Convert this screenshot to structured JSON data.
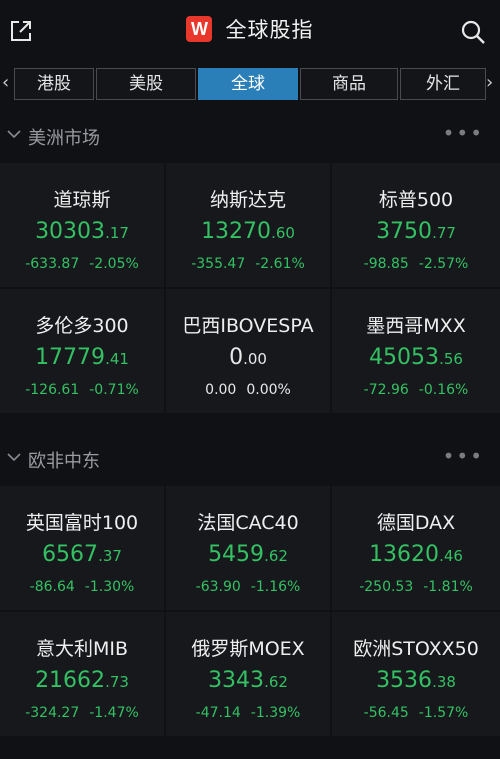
{
  "header": {
    "title": "全球股指",
    "logo_letter": "W",
    "icons": {
      "left": "share-external-icon",
      "right": "search-icon"
    }
  },
  "tabs": {
    "items": [
      {
        "label": "港股"
      },
      {
        "label": "美股"
      },
      {
        "label": "全球",
        "active": true
      },
      {
        "label": "商品"
      },
      {
        "label": "外汇"
      }
    ],
    "left_arrow": "‹",
    "right_arrow": "›"
  },
  "sections": [
    {
      "title": "美洲市场",
      "more": "•••",
      "items": [
        {
          "name": "道琼斯",
          "price_int": "30303",
          "price_dec": ".17",
          "change": "-633.87",
          "pct": "-2.05%"
        },
        {
          "name": "纳斯达克",
          "price_int": "13270",
          "price_dec": ".60",
          "change": "-355.47",
          "pct": "-2.61%"
        },
        {
          "name": "标普500",
          "price_int": "3750",
          "price_dec": ".77",
          "change": "-98.85",
          "pct": "-2.57%"
        },
        {
          "name": "多伦多300",
          "price_int": "17779",
          "price_dec": ".41",
          "change": "-126.61",
          "pct": "-0.71%"
        },
        {
          "name": "巴西IBOVESPA",
          "price_int": "0",
          "price_dec": ".00",
          "change": "0.00",
          "pct": "0.00%"
        },
        {
          "name": "墨西哥MXX",
          "price_int": "45053",
          "price_dec": ".56",
          "change": "-72.96",
          "pct": "-0.16%"
        }
      ]
    },
    {
      "title": "欧非中东",
      "more": "•••",
      "items": [
        {
          "name": "英国富时100",
          "price_int": "6567",
          "price_dec": ".37",
          "change": "-86.64",
          "pct": "-1.30%"
        },
        {
          "name": "法国CAC40",
          "price_int": "5459",
          "price_dec": ".62",
          "change": "-63.90",
          "pct": "-1.16%"
        },
        {
          "name": "德国DAX",
          "price_int": "13620",
          "price_dec": ".46",
          "change": "-250.53",
          "pct": "-1.81%"
        },
        {
          "name": "意大利MIB",
          "price_int": "21662",
          "price_dec": ".73",
          "change": "-324.27",
          "pct": "-1.47%"
        },
        {
          "name": "俄罗斯MOEX",
          "price_int": "3343",
          "price_dec": ".62",
          "change": "-47.14",
          "pct": "-1.39%"
        },
        {
          "name": "欧洲STOXX50",
          "price_int": "3536",
          "price_dec": ".38",
          "change": "-56.45",
          "pct": "-1.57%"
        }
      ]
    }
  ],
  "colors": {
    "background": "#101114",
    "cell": "#17181c",
    "down": "#33c163",
    "active_tab": "#2a7fb8",
    "logo": "#e8382c"
  }
}
